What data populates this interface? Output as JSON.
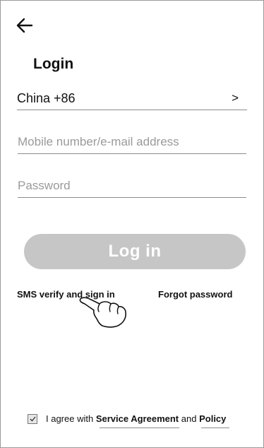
{
  "header": {
    "back_icon": "arrow-left-icon",
    "title": "Login"
  },
  "country": {
    "value": "China +86",
    "chevron": ">"
  },
  "fields": {
    "mobile_placeholder": "Mobile number/e-mail address",
    "mobile_value": "",
    "password_placeholder": "Password",
    "password_value": ""
  },
  "login_button": {
    "label": "Log in",
    "color": "#c6c6c6"
  },
  "links": {
    "sms": "SMS verify and sign in",
    "forgot": "Forgot password"
  },
  "pointer_icon": "hand-pointer-icon",
  "agreement": {
    "checked": true,
    "prefix": "I agree with",
    "service": "Service Agreement",
    "conjunction": "and",
    "policy": "Policy"
  }
}
